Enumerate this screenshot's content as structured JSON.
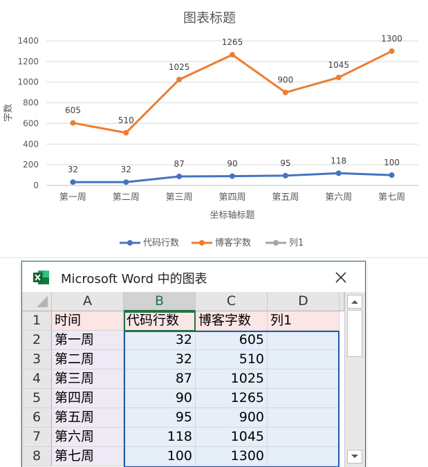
{
  "chart_data": {
    "type": "line",
    "title": "图表标题",
    "xlabel": "坐标轴标题",
    "ylabel": "字数",
    "categories": [
      "第一周",
      "第二周",
      "第三周",
      "第四周",
      "第五周",
      "第六周",
      "第七周"
    ],
    "ylim": [
      0,
      1400
    ],
    "yticks": [
      0,
      200,
      400,
      600,
      800,
      1000,
      1200,
      1400
    ],
    "grid": true,
    "legend_position": "bottom",
    "series": [
      {
        "name": "代码行数",
        "values": [
          32,
          32,
          87,
          90,
          95,
          118,
          100
        ],
        "color": "#4472c4"
      },
      {
        "name": "博客字数",
        "values": [
          605,
          510,
          1025,
          1265,
          900,
          1045,
          1300
        ],
        "color": "#ed7d31"
      },
      {
        "name": "列1",
        "values": [
          null,
          null,
          null,
          null,
          null,
          null,
          null
        ],
        "color": "#a5a5a5"
      }
    ]
  },
  "sheet": {
    "title": "Microsoft Word 中的图表",
    "columns": [
      "A",
      "B",
      "C",
      "D"
    ],
    "selected_column": "B",
    "rows": [
      {
        "row": "1",
        "cells": [
          "时间",
          "代码行数",
          "博客字数",
          "列1"
        ]
      },
      {
        "row": "2",
        "cells": [
          "第一周",
          "32",
          "605",
          ""
        ]
      },
      {
        "row": "3",
        "cells": [
          "第二周",
          "32",
          "510",
          ""
        ]
      },
      {
        "row": "4",
        "cells": [
          "第三周",
          "87",
          "1025",
          ""
        ]
      },
      {
        "row": "5",
        "cells": [
          "第四周",
          "90",
          "1265",
          ""
        ]
      },
      {
        "row": "6",
        "cells": [
          "第五周",
          "95",
          "900",
          ""
        ]
      },
      {
        "row": "7",
        "cells": [
          "第六周",
          "118",
          "1045",
          ""
        ]
      },
      {
        "row": "8",
        "cells": [
          "第七周",
          "100",
          "1300",
          ""
        ]
      }
    ]
  },
  "icons": {
    "app_icon": "excel-icon",
    "close": "close-icon",
    "scroll_up": "chevron-up-icon",
    "scroll_down": "chevron-down-icon"
  }
}
